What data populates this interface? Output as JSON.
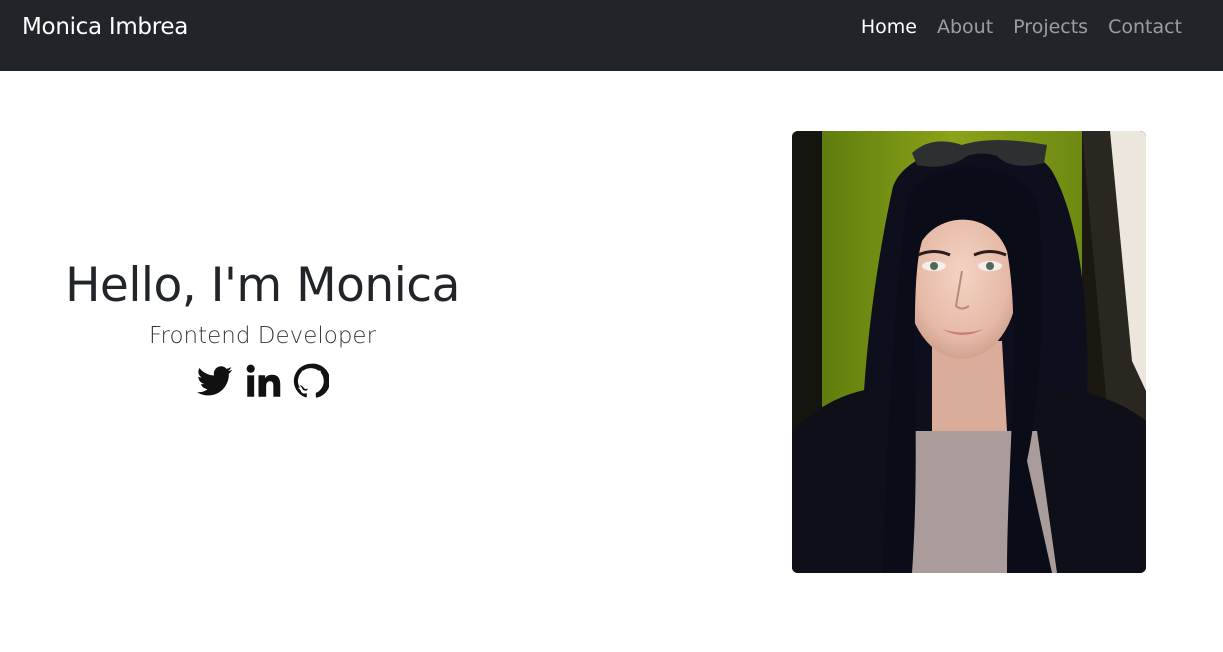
{
  "navbar": {
    "brand": "Monica Imbrea",
    "links": [
      {
        "label": "Home",
        "active": true
      },
      {
        "label": "About",
        "active": false
      },
      {
        "label": "Projects",
        "active": false
      },
      {
        "label": "Contact",
        "active": false
      }
    ]
  },
  "hero": {
    "headline": "Hello, I'm Monica",
    "subtitle": "Frontend Developer",
    "socials": [
      {
        "icon": "twitter-icon"
      },
      {
        "icon": "linkedin-icon"
      },
      {
        "icon": "github-icon"
      }
    ]
  },
  "colors": {
    "navbar_bg": "#212529",
    "nav_active": "#ffffff",
    "nav_inactive": "#9a9da0",
    "text_dark": "#212529",
    "photo_wall_green": "#7a9a12"
  }
}
